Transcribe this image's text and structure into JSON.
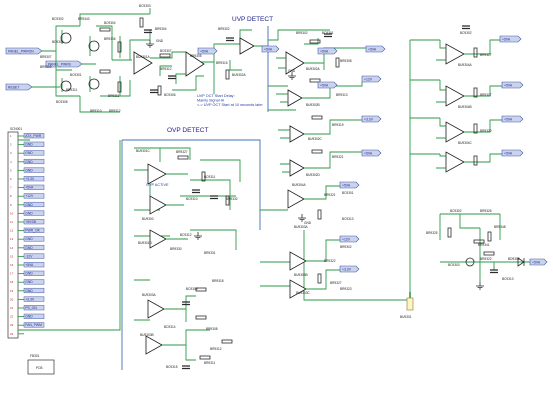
{
  "titles": {
    "uvp": "UVP DETECT",
    "ovp": "OVP DETECT"
  },
  "notes": {
    "uvp_delay": "UVP OCT Start Delay:\nMainly Signal Hi\n<-> UVP OCT Start at 10 seconds later",
    "ovp_active": "OVP ACTIVE"
  },
  "input_flags": [
    "PANEL_PWRON",
    "PANEL_PWRS",
    "RESET",
    "+5VA"
  ],
  "top_flags": [
    "+5VA",
    "+5VA",
    "+5VA",
    "+5VA"
  ],
  "output_flags": [
    "+5VA",
    "+12V",
    "+3.3V",
    "+5VA",
    "+5VA",
    "+5VA",
    "+5VA",
    "+5VA"
  ],
  "connector": {
    "ref": "SCN001",
    "pins": [
      "ATX_PWR",
      "GND",
      "GND",
      "GND",
      "GND",
      "+3.3V",
      "+5VA",
      "+12V",
      "GND",
      "GND",
      "+5VSB",
      "PWR_OK",
      "GND",
      "GND",
      "-12V",
      "+5VA",
      "GND",
      "GND",
      "GND",
      "+3.3V",
      "PS_ON",
      "GND",
      "FAN_PWM"
    ],
    "pin_numbers": [
      "1",
      "2",
      "3",
      "4",
      "5",
      "6",
      "7",
      "8",
      "9",
      "10",
      "11",
      "12",
      "13",
      "14",
      "15",
      "16",
      "17",
      "18",
      "19",
      "20",
      "21",
      "22",
      "23",
      "24"
    ]
  },
  "refs": {
    "uvp_block": [
      "BC9302",
      "BR9343",
      "BC9304",
      "BR9306",
      "BC9305",
      "BR9307",
      "BR9309",
      "BR9340",
      "BC9301",
      "BR9311",
      "BR9312",
      "BC9308",
      "BR9310",
      "BC9303",
      "BR9304",
      "BU9301A",
      "BR9305",
      "BC9307",
      "BC9306",
      "BR9315",
      "BR9302",
      "BU9302A",
      "BC9301",
      "GND"
    ],
    "uvp_right": [
      "BR9308",
      "BU9302B",
      "BR9313",
      "BU9302C",
      "BR9319",
      "BR9321",
      "BU9302D",
      "BC9302",
      "BU9304A",
      "BR9327",
      "BU9304B",
      "BR9317",
      "BU9304C",
      "BR9320"
    ],
    "ovp_block": [
      "BU9301C",
      "BR9327",
      "BC9311",
      "BC9310",
      "BR9332",
      "BU9300",
      "BU9301D",
      "BR9330",
      "BR9331",
      "BC9312",
      "BR9308",
      "BU9303A",
      "BC9309",
      "BR9318",
      "BC9314",
      "BR9308",
      "BU9303B",
      "BR9312",
      "BC9315",
      "BR9311",
      "BR9329"
    ],
    "ovp_right": [
      "BU9304A",
      "BR9321",
      "BC9301",
      "BU9303A",
      "BC9313",
      "GND",
      "BU9303B",
      "BR9302",
      "BR9322",
      "BR9327",
      "BR9322",
      "BU9303C",
      "BR9323"
    ],
    "bottom_right": [
      "BC9302",
      "BR9326",
      "BR9325",
      "BR9348",
      "BR9341",
      "BC9303",
      "BR9322",
      "BC9313",
      "BD9302"
    ],
    "test_point": "FB301",
    "bus_ref": "BU9301"
  },
  "bottom_box": "PCB"
}
